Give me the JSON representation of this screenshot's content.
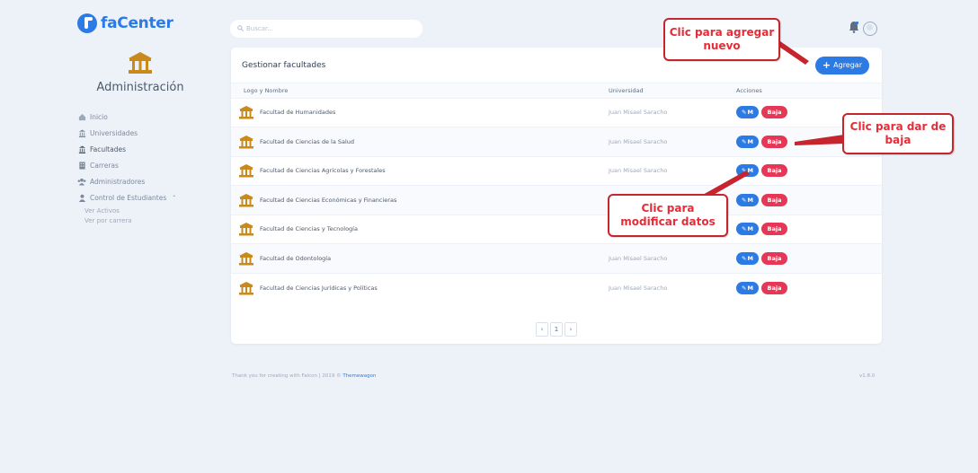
{
  "brand": {
    "name": "faCenter"
  },
  "sidebar": {
    "section_label": "Administración",
    "items": [
      {
        "label": "Inicio",
        "icon": "home-icon"
      },
      {
        "label": "Universidades",
        "icon": "university-icon"
      },
      {
        "label": "Facultades",
        "icon": "institution-icon"
      },
      {
        "label": "Carreras",
        "icon": "building-icon"
      },
      {
        "label": "Administradores",
        "icon": "users-icon"
      },
      {
        "label": "Control de Estudiantes",
        "icon": "student-icon"
      }
    ],
    "sub_items": [
      "Ver Activos",
      "Ver por carrera"
    ]
  },
  "search": {
    "placeholder": "Buscar..."
  },
  "card": {
    "title": "Gestionar facultades",
    "add_label": "Agregar",
    "columns": [
      "Logo y Nombre",
      "Universidad",
      "Acciones"
    ],
    "rows": [
      {
        "name": "Facultad de Humanidades",
        "university": "Juan Misael Saracho"
      },
      {
        "name": "Facultad de Ciencias de la Salud",
        "university": "Juan Misael Saracho"
      },
      {
        "name": "Facultad de Ciencias Agrícolas y Forestales",
        "university": "Juan Misael Saracho"
      },
      {
        "name": "Facultad de Ciencias Económicas y Financieras",
        "university": ""
      },
      {
        "name": "Facultad de Ciencias y Tecnología",
        "university": ""
      },
      {
        "name": "Facultad de Odontología",
        "university": "Juan Misael Saracho"
      },
      {
        "name": "Facultad de Ciencias Jurídicas y Políticas",
        "university": "Juan Misael Saracho"
      }
    ],
    "modify_label": "M",
    "delete_label": "Baja",
    "pager": {
      "prev": "‹",
      "current": "1",
      "next": "›"
    }
  },
  "footer": {
    "text": "Thank you for creating with Falcon | 2019 © ",
    "link": "Themewagon",
    "version": "v1.8.0"
  },
  "callouts": {
    "add": "Clic para agregar nuevo",
    "delete": "Clic para dar de baja",
    "modify": "Clic para modificar datos"
  },
  "colors": {
    "primary": "#2c7be5",
    "danger": "#e63757",
    "callout_red": "#e52c38"
  }
}
